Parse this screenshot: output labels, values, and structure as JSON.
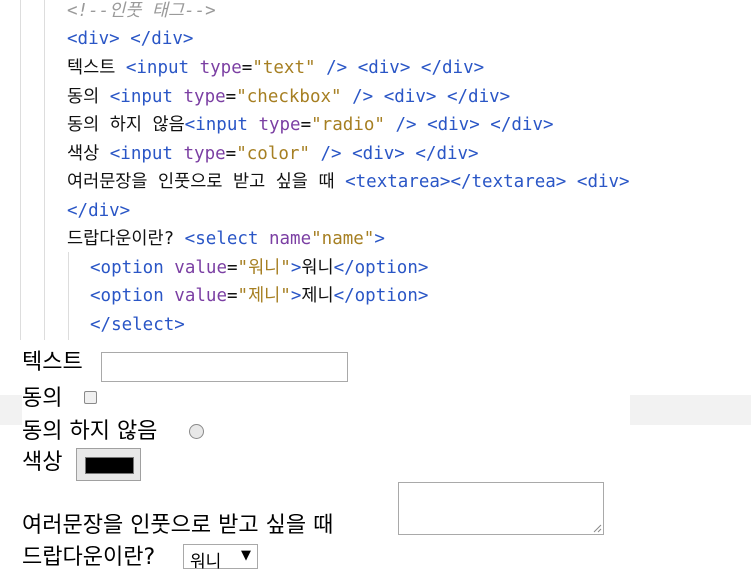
{
  "code": {
    "comment": "<!--인풋 태그-->",
    "line_div_open": "<div>",
    "line_div_close": "</div>",
    "text_label": "텍스트 ",
    "text_input_tag": "<input ",
    "type_attr": "type",
    "eq": "=",
    "text_type_val": "\"text\"",
    "self_close": " />",
    "agree_label": "동의 ",
    "checkbox_type_val": "\"checkbox\"",
    "disagree_label": "동의 하지 않음",
    "radio_type_val": "\"radio\"",
    "color_label": "색상 ",
    "color_type_val": "\"color\"",
    "textarea_label": "여러문장을 인풋으로 받고 싶을 때 ",
    "textarea_open": "<textarea>",
    "textarea_close": "</textarea>",
    "dropdown_label": "드랍다운이란? ",
    "select_open": "<select ",
    "name_attr": "name",
    "name_val": "\"name\"",
    "select_open_end": ">",
    "option_open": "<option ",
    "value_attr": "value",
    "option1_val": "\"워니\"",
    "option1_text": "워니",
    "option2_val": "\"제니\"",
    "option2_text": "제니",
    "option_close": "</option>",
    "select_close": "</select>"
  },
  "form": {
    "text_label": "텍스트",
    "text_value": "",
    "agree_label": "동의",
    "disagree_label": "동의 하지 않음",
    "color_label": "색상",
    "color_value": "#000000",
    "textarea_label": "여러문장을 인풋으로 받고 싶을 때",
    "textarea_value": "",
    "dropdown_label": "드랍다운이란?",
    "select_selected": "워니",
    "select_options": [
      "워니",
      "제니"
    ]
  }
}
